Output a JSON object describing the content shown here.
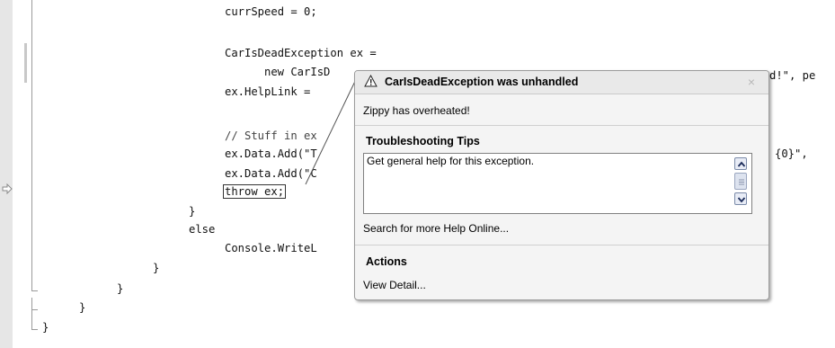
{
  "code_lines": [
    "currSpeed = 0;",
    "CarIsDeadException ex =",
    "new CarIsD",
    "ex.HelpLink =",
    "// Stuff in ex",
    "ex.Data.Add(\"T",
    "ex.Data.Add(\"C",
    "throw ex;",
    "}",
    "else",
    "Console.WriteL",
    "}",
    "}",
    "}",
    "}"
  ],
  "code_fragments": {
    "line3_tail": "d!\", pe",
    "line6_tail": "{0}\","
  },
  "exception_popup": {
    "title": "CarIsDeadException was unhandled",
    "close_glyph": "×",
    "message": "Zippy has overheated!",
    "troubleshooting_title": "Troubleshooting Tips",
    "tips": [
      "Get general help for this exception."
    ],
    "search_link": "Search for more Help Online...",
    "actions_title": "Actions",
    "actions": [
      "View Detail..."
    ]
  },
  "icons": {
    "warning": "warning-icon",
    "exec_pointer": "execution-arrow-icon",
    "scroll_up": "scroll-up-icon",
    "scroll_down": "scroll-down-icon"
  }
}
